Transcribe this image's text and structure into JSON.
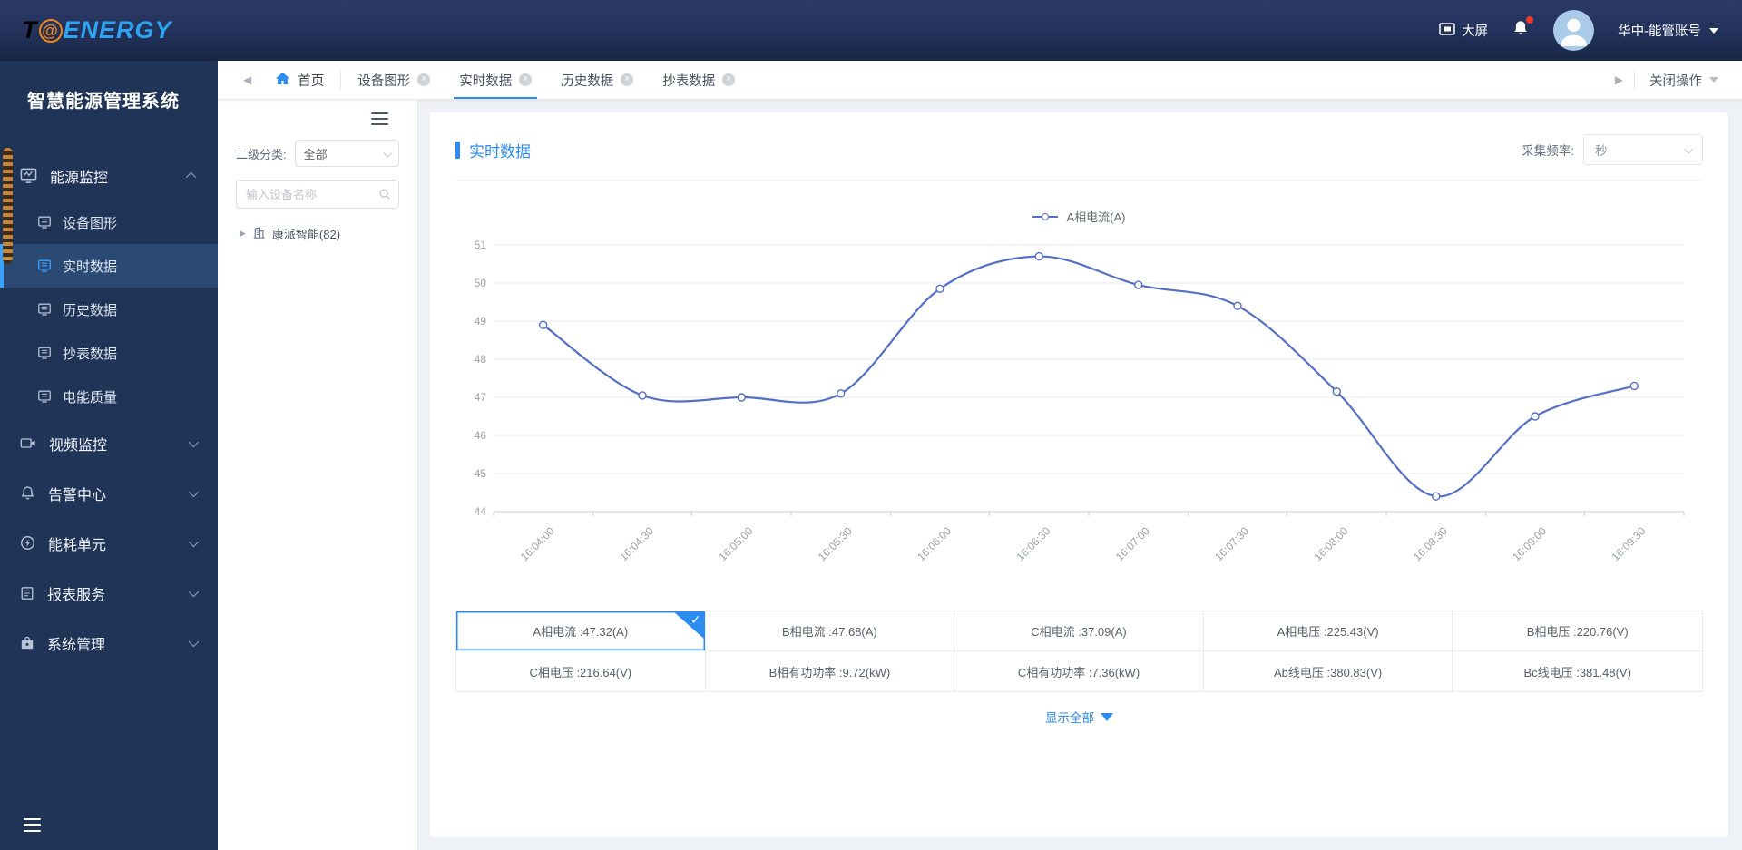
{
  "header": {
    "logo_t": "T",
    "logo_at": "@",
    "logo_rest": "ENERGY",
    "big_screen_label": "大屏",
    "account_label": "华中-能管账号"
  },
  "sidebar": {
    "title": "智慧能源管理系统",
    "menu": [
      {
        "label": "能源监控",
        "icon": "energy-monitor-icon",
        "expanded": true,
        "children": [
          {
            "label": "设备图形",
            "icon": "device-graphic-icon",
            "active": false
          },
          {
            "label": "实时数据",
            "icon": "realtime-data-icon",
            "active": true
          },
          {
            "label": "历史数据",
            "icon": "history-data-icon",
            "active": false
          },
          {
            "label": "抄表数据",
            "icon": "meter-data-icon",
            "active": false
          },
          {
            "label": "电能质量",
            "icon": "power-quality-icon",
            "active": false
          }
        ]
      },
      {
        "label": "视频监控",
        "icon": "video-monitor-icon",
        "expanded": false
      },
      {
        "label": "告警中心",
        "icon": "alarm-center-icon",
        "expanded": false
      },
      {
        "label": "能耗单元",
        "icon": "energy-unit-icon",
        "expanded": false
      },
      {
        "label": "报表服务",
        "icon": "report-service-icon",
        "expanded": false
      },
      {
        "label": "系统管理",
        "icon": "system-manage-icon",
        "expanded": false
      }
    ]
  },
  "tabbar": {
    "home_label": "首页",
    "tabs": [
      {
        "label": "设备图形",
        "closable": true,
        "active": false
      },
      {
        "label": "实时数据",
        "closable": true,
        "active": true
      },
      {
        "label": "历史数据",
        "closable": true,
        "active": false
      },
      {
        "label": "抄表数据",
        "closable": true,
        "active": false
      }
    ],
    "close_ops_label": "关闭操作"
  },
  "filter_panel": {
    "category_label": "二级分类:",
    "category_value": "全部",
    "search_placeholder": "输入设备名称",
    "tree_items": [
      {
        "label": "康派智能(82)"
      }
    ]
  },
  "main": {
    "section_title": "实时数据",
    "freq_label": "采集频率:",
    "freq_value": "秒",
    "show_all_label": "显示全部"
  },
  "chart_data": {
    "type": "line",
    "title": "",
    "xlabel": "",
    "ylabel": "",
    "legend": [
      "A相电流(A)"
    ],
    "legend_position": "top",
    "grid": true,
    "smooth": true,
    "line_color": "#5470c6",
    "x": [
      "16:04:00",
      "16:04:30",
      "16:05:00",
      "16:05:30",
      "16:06:00",
      "16:06:30",
      "16:07:00",
      "16:07:30",
      "16:08:00",
      "16:08:30",
      "16:09:00",
      "16:09:30"
    ],
    "series": [
      {
        "name": "A相电流(A)",
        "values": [
          48.9,
          47.05,
          47.0,
          47.1,
          49.85,
          50.7,
          49.95,
          49.4,
          47.15,
          44.4,
          46.5,
          47.3
        ]
      }
    ],
    "ylim": [
      44,
      51
    ],
    "y_ticks": [
      44,
      45,
      46,
      47,
      48,
      49,
      50,
      51
    ]
  },
  "data_table": {
    "rows": [
      [
        {
          "label": "A相电流 :47.32(A)",
          "selected": true
        },
        {
          "label": "B相电流 :47.68(A)",
          "selected": false
        },
        {
          "label": "C相电流 :37.09(A)",
          "selected": false
        },
        {
          "label": "A相电压 :225.43(V)",
          "selected": false
        },
        {
          "label": "B相电压 :220.76(V)",
          "selected": false
        }
      ],
      [
        {
          "label": "C相电压 :216.64(V)",
          "selected": false
        },
        {
          "label": "B相有功功率 :9.72(kW)",
          "selected": false
        },
        {
          "label": "C相有功功率 :7.36(kW)",
          "selected": false
        },
        {
          "label": "Ab线电压 :380.83(V)",
          "selected": false
        },
        {
          "label": "Bc线电压 :381.48(V)",
          "selected": false
        }
      ]
    ]
  },
  "colors": {
    "accent_blue": "#2d8cf0",
    "line_blue": "#5470c6",
    "header_bg": "#22315a",
    "sidebar_bg": "#203457",
    "sidebar_active_bg": "#2b4a73",
    "content_bg": "#eef1f6"
  }
}
